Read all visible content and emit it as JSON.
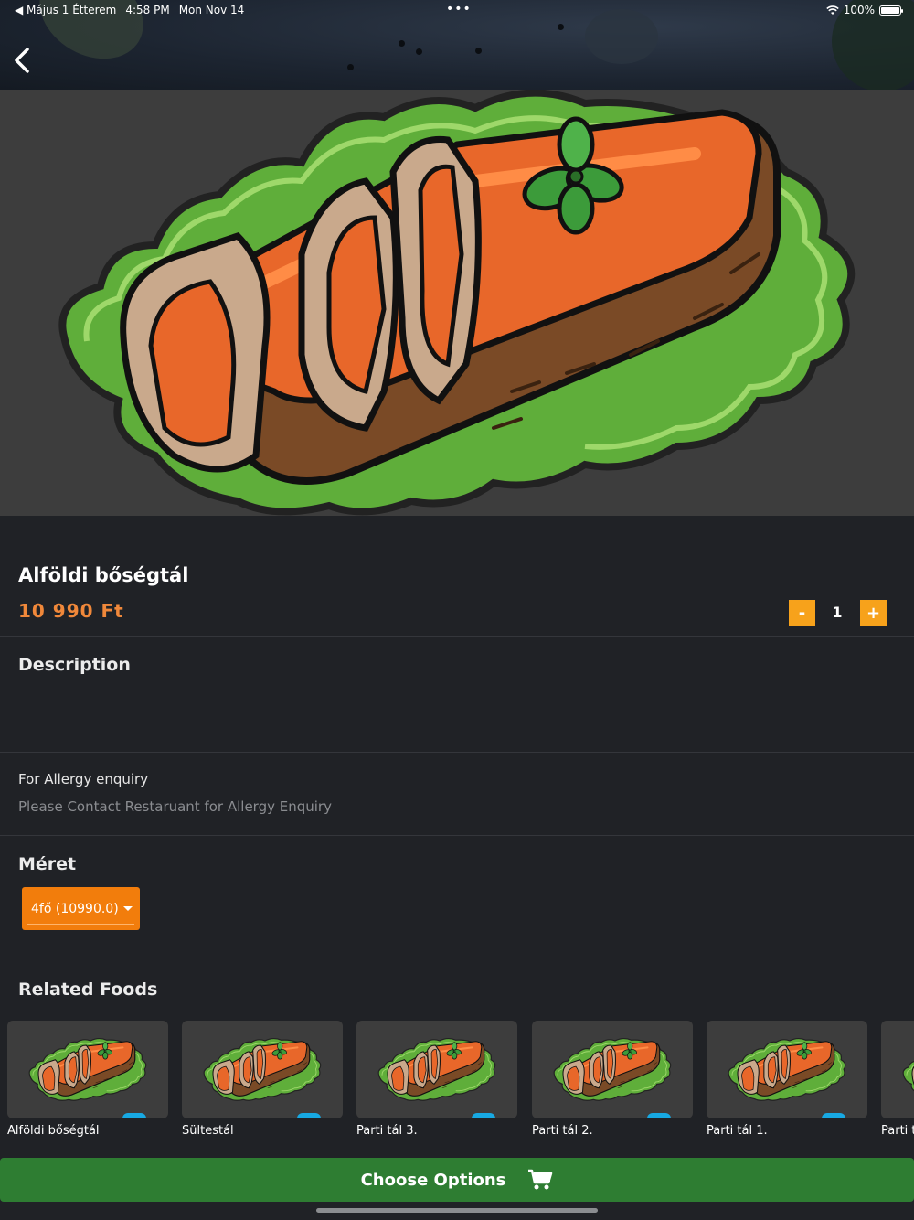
{
  "status_bar": {
    "back_app": "◀ Május 1 Étterem",
    "time": "4:58 PM",
    "date": "Mon Nov 14",
    "dots": "•••",
    "battery": "100%"
  },
  "item": {
    "title": "Alföldi bőségtál",
    "price": "10 990 Ft",
    "quantity": "1",
    "minus_label": "-",
    "plus_label": "+"
  },
  "description": {
    "heading": "Description"
  },
  "allergy": {
    "title": "For Allergy enquiry",
    "text": "Please Contact Restaruant for Allergy Enquiry"
  },
  "size": {
    "heading": "Méret",
    "selected": "4fő  (10990.0)"
  },
  "related": {
    "heading": "Related Foods",
    "items": [
      {
        "name": "Alföldi bőségtál"
      },
      {
        "name": "Sültestál"
      },
      {
        "name": "Parti tál 3."
      },
      {
        "name": "Parti tál 2."
      },
      {
        "name": "Parti tál 1."
      },
      {
        "name": "Parti t"
      }
    ]
  },
  "footer": {
    "choose_label": "Choose Options"
  },
  "colors": {
    "accent_orange": "#f7a21b",
    "price_orange": "#f0883a",
    "button_green": "#2e7d32",
    "background": "#202226"
  }
}
